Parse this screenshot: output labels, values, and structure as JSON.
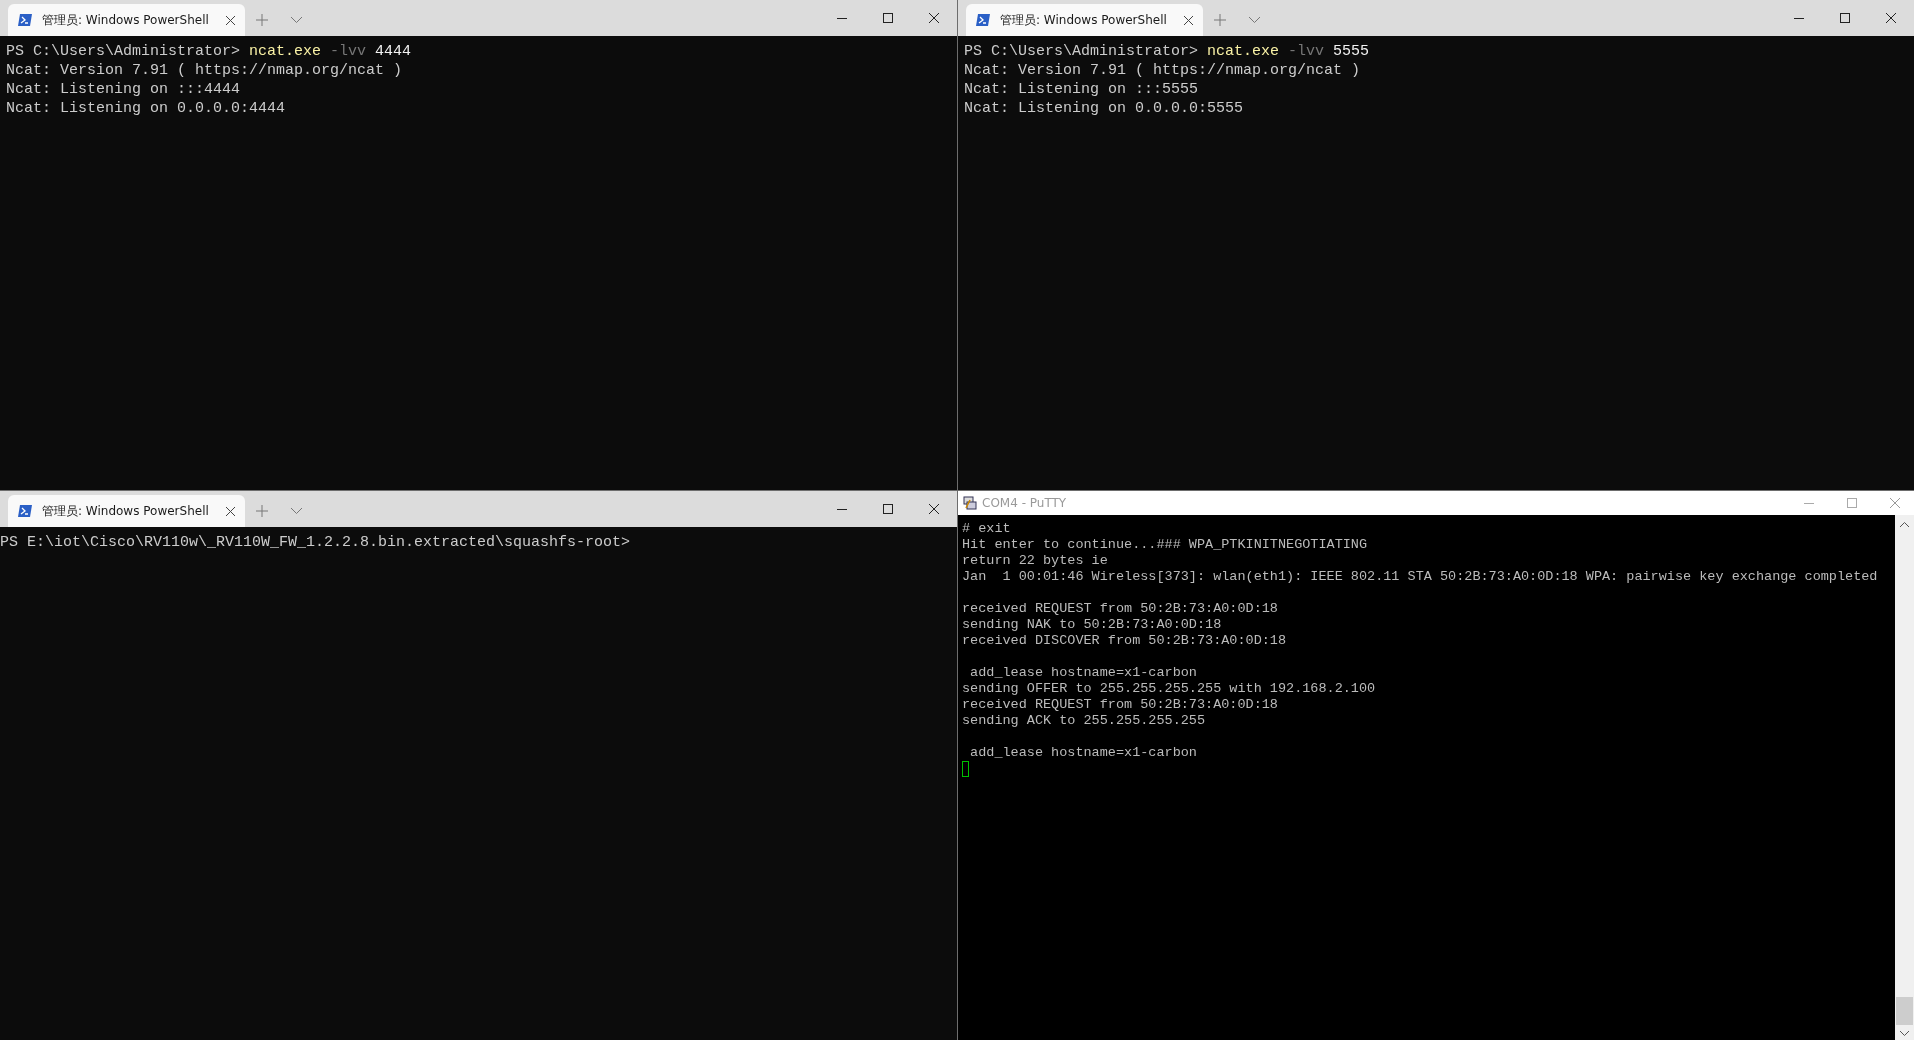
{
  "windows": [
    {
      "kind": "terminal",
      "tab": {
        "title": "管理员: Windows PowerShell",
        "selected": true
      },
      "lines": [
        [
          {
            "kind": "prompt",
            "text": "PS C:\\Users\\Administrator> "
          },
          {
            "kind": "command",
            "text": "ncat.exe"
          },
          {
            "kind": "flag",
            "text": " -lvv"
          },
          {
            "kind": "arg",
            "text": " 4444"
          }
        ],
        [
          {
            "kind": "output",
            "text": "Ncat: Version 7.91 ( https://nmap.org/ncat )"
          }
        ],
        [
          {
            "kind": "output",
            "text": "Ncat: Listening on :::4444"
          }
        ],
        [
          {
            "kind": "output",
            "text": "Ncat: Listening on 0.0.0.0:4444"
          }
        ]
      ]
    },
    {
      "kind": "terminal",
      "tab": {
        "title": "管理员: Windows PowerShell",
        "selected": true
      },
      "lines": [
        [
          {
            "kind": "prompt",
            "text": "PS C:\\Users\\Administrator> "
          },
          {
            "kind": "command",
            "text": "ncat.exe"
          },
          {
            "kind": "flag",
            "text": " -lvv"
          },
          {
            "kind": "arg",
            "text": " 5555"
          }
        ],
        [
          {
            "kind": "output",
            "text": "Ncat: Version 7.91 ( https://nmap.org/ncat )"
          }
        ],
        [
          {
            "kind": "output",
            "text": "Ncat: Listening on :::5555"
          }
        ],
        [
          {
            "kind": "output",
            "text": "Ncat: Listening on 0.0.0.0:5555"
          }
        ]
      ]
    },
    {
      "kind": "terminal",
      "tab": {
        "title": "管理员: Windows PowerShell",
        "selected": true
      },
      "lines": [
        [
          {
            "kind": "prompt",
            "text": "PS E:\\iot\\Cisco\\RV110w\\_RV110W_FW_1.2.2.8.bin.extracted\\squashfs-root>"
          }
        ]
      ]
    },
    {
      "kind": "putty",
      "title": "COM4 - PuTTY",
      "lines": [
        {
          "kind": "text",
          "text": "# exit"
        },
        {
          "kind": "text",
          "text": "Hit enter to continue...### WPA_PTKINITNEGOTIATING"
        },
        {
          "kind": "text",
          "text": "return 22 bytes ie"
        },
        {
          "kind": "text",
          "text": "Jan  1 00:01:46 Wireless[373]: wlan(eth1): IEEE 802.11 STA 50:2B:73:A0:0D:18 WPA: pairwise key exchange completed"
        },
        {
          "kind": "blank"
        },
        {
          "kind": "text",
          "text": "received REQUEST from 50:2B:73:A0:0D:18"
        },
        {
          "kind": "text",
          "text": "sending NAK to 50:2B:73:A0:0D:18"
        },
        {
          "kind": "text",
          "text": "received DISCOVER from 50:2B:73:A0:0D:18"
        },
        {
          "kind": "blank"
        },
        {
          "kind": "text",
          "text": " add_lease hostname=x1-carbon"
        },
        {
          "kind": "text",
          "text": "sending OFFER to 255.255.255.255 with 192.168.2.100"
        },
        {
          "kind": "text",
          "text": "received REQUEST from 50:2B:73:A0:0D:18"
        },
        {
          "kind": "text",
          "text": "sending ACK to 255.255.255.255"
        },
        {
          "kind": "blank"
        },
        {
          "kind": "text",
          "text": " add_lease hostname=x1-carbon"
        }
      ]
    }
  ]
}
